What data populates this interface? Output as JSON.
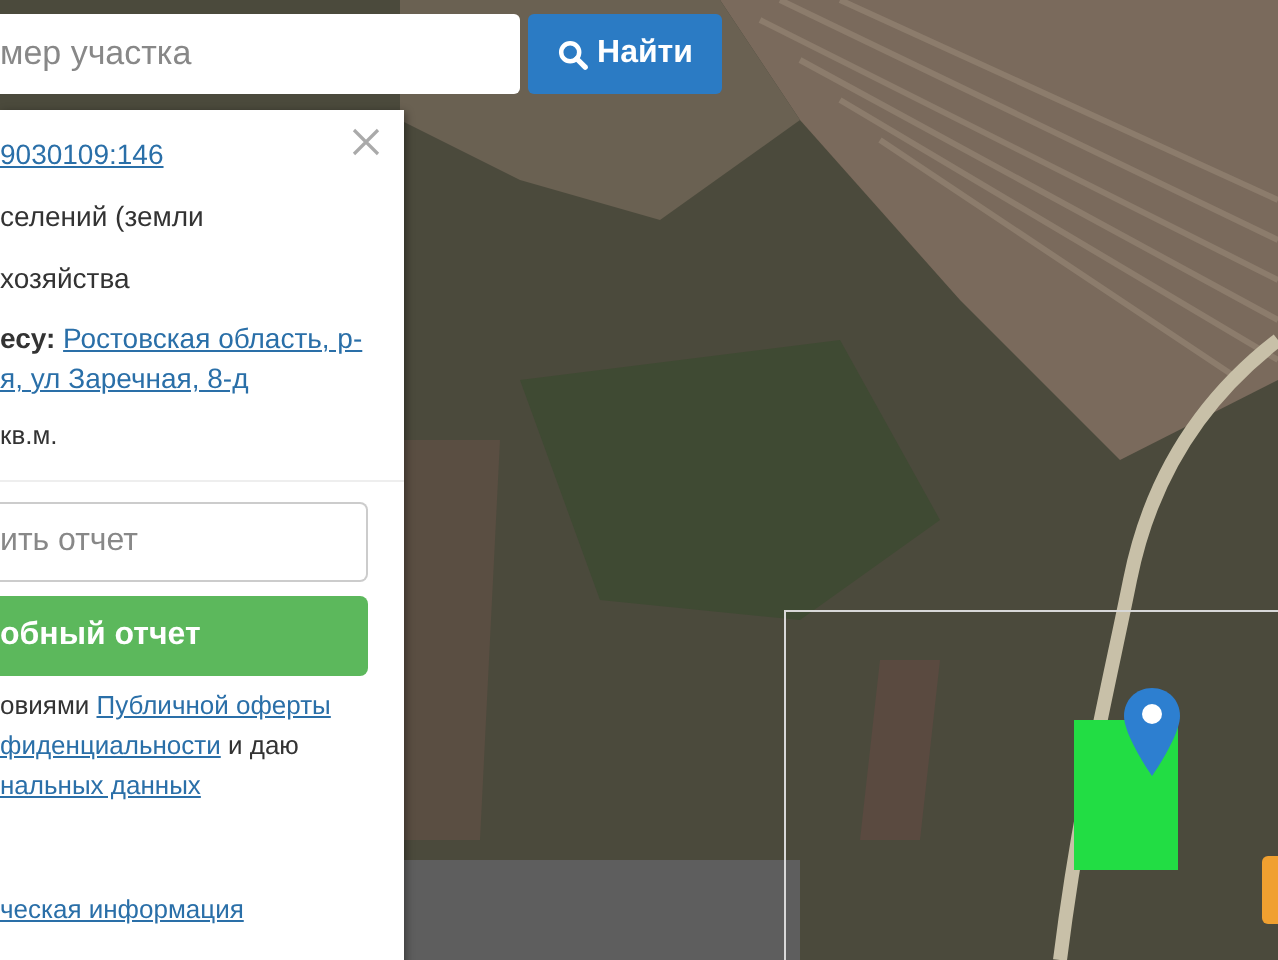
{
  "search": {
    "placeholder": "мер участка",
    "button": "Найти"
  },
  "info_panel": {
    "cadastral_number": "9030109:146",
    "category_lines": [
      "селений (земли",
      "хозяйства"
    ],
    "address_label": "есу:",
    "address_lines": [
      "Ростовская область, р-",
      "я, ул Заречная, 8-д"
    ],
    "area": "кв.м.",
    "report_field": {
      "placeholder": "ить отчет"
    },
    "report_button": "обный отчет",
    "consent_lines": [
      [
        {
          "kind": "text",
          "text": "овиями "
        },
        {
          "kind": "link",
          "text": "Публичной оферты"
        }
      ],
      [
        {
          "kind": "link",
          "text": "фиденциальности"
        },
        {
          "kind": "text",
          "text": " и даю"
        }
      ],
      [
        {
          "kind": "link",
          "text": "нальных данных"
        }
      ]
    ],
    "footer_link": "ческая информация"
  }
}
